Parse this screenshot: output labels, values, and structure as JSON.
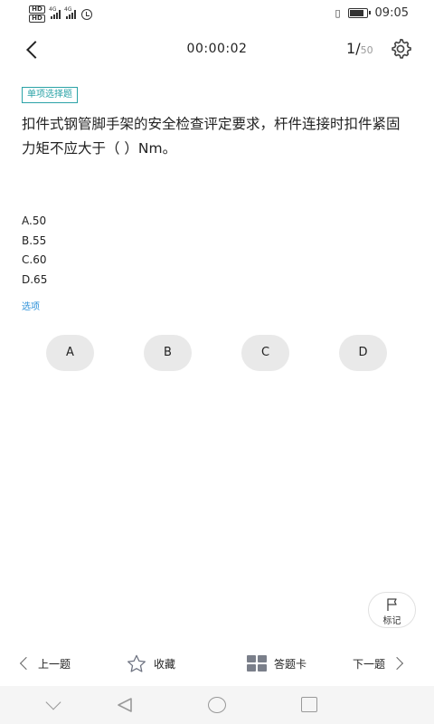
{
  "status_bar": {
    "hd_label": "HD",
    "network_label": "4G",
    "time": "09:05"
  },
  "header": {
    "timer": "00:00:02",
    "current_question": "1",
    "slash": "/",
    "total_questions": "50"
  },
  "question": {
    "type_badge": "单项选择题",
    "text": "扣件式钢管脚手架的安全检查评定要求，杆件连接时扣件紧固力矩不应大于（ ）Nm。",
    "options": [
      {
        "label": "A.50"
      },
      {
        "label": "B.55"
      },
      {
        "label": "C.60"
      },
      {
        "label": "D.65"
      }
    ],
    "section_label": "选项"
  },
  "answer_buttons": [
    {
      "label": "A"
    },
    {
      "label": "B"
    },
    {
      "label": "C"
    },
    {
      "label": "D"
    }
  ],
  "mark": {
    "label": "标记"
  },
  "toolbar": {
    "prev_label": "上一题",
    "favorite_label": "收藏",
    "answer_card_label": "答题卡",
    "next_label": "下一题"
  },
  "colors": {
    "accent": "#2ba3a7",
    "link": "#2a8fd8",
    "answer_button_bg": "#e9e9e9"
  }
}
